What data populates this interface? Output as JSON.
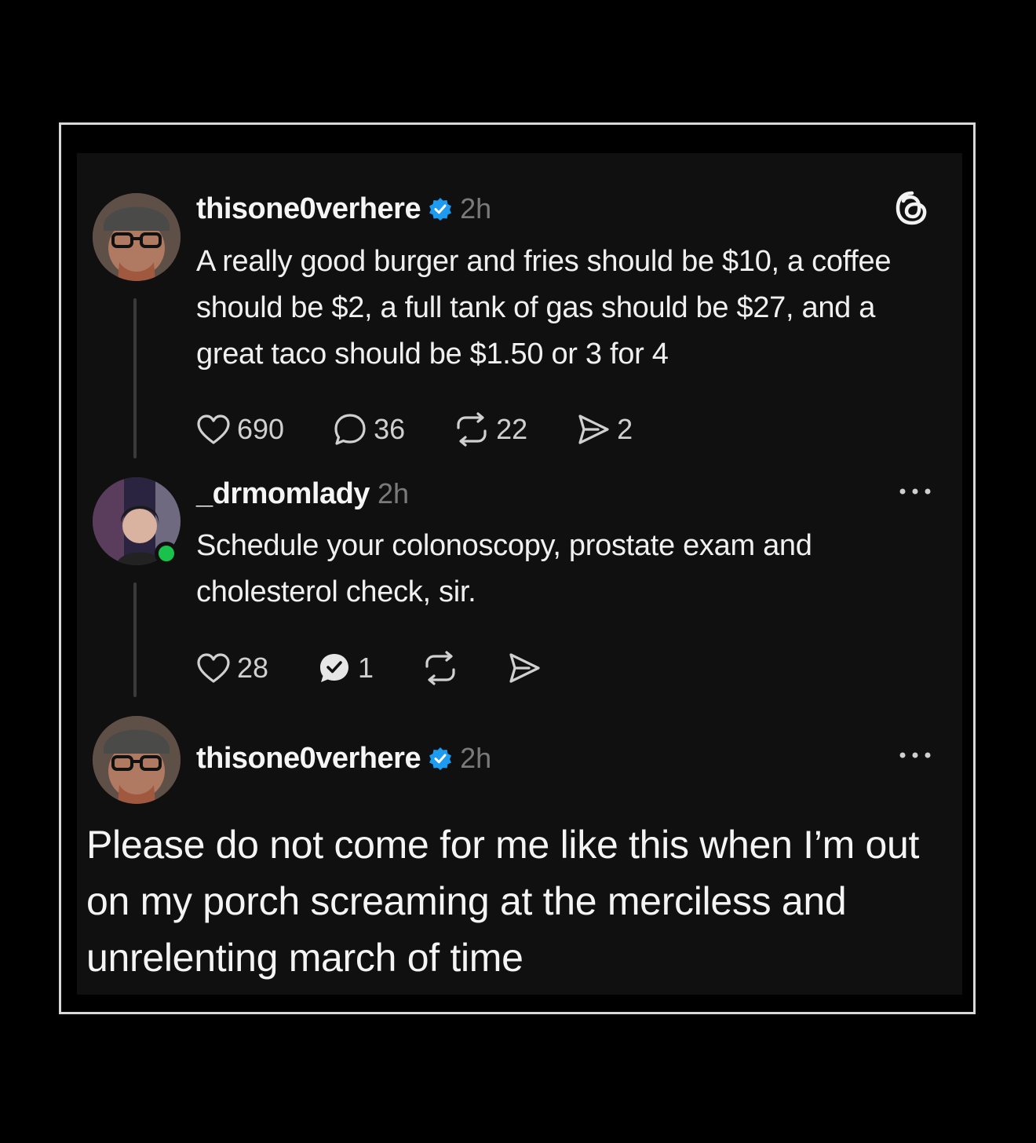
{
  "posts": [
    {
      "username": "thisone0verhere",
      "verified": true,
      "time": "2h",
      "text": "A really good burger and fries should be $10, a coffee should be $2, a full tank of gas should be $27, and a great taco should be $1.50 or 3 for 4",
      "likes": "690",
      "replies": "36",
      "reposts": "22",
      "shares": "2"
    },
    {
      "username": "_drmomlady",
      "verified": false,
      "time": "2h",
      "text": "Schedule your colonoscopy, prostate exam and cholesterol check, sir.",
      "likes": "28",
      "replies": "1",
      "online": true
    },
    {
      "username": "thisone0verhere",
      "verified": true,
      "time": "2h"
    }
  ],
  "reply_text": "Please do not come for me like this when I’m out on my porch screaming at the merciless and unrelenting march of time",
  "icons": {
    "like": "heart-icon",
    "reply": "speech-bubble-icon",
    "repost": "repost-icon",
    "share": "send-icon",
    "verified": "verified-badge-icon",
    "app": "threads-logo-icon",
    "more": "more-dots-icon"
  },
  "colors": {
    "verified_blue": "#1d9bf0",
    "online_green": "#19c24b",
    "background": "#101010"
  }
}
